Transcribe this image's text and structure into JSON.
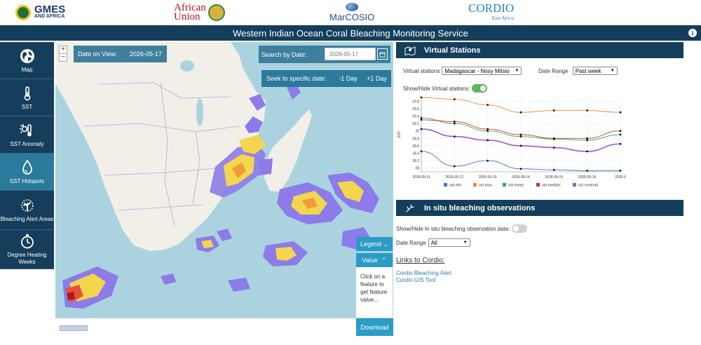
{
  "logos": {
    "gmes": {
      "line1": "GMES",
      "line2": "AND AFRICA"
    },
    "african_union": {
      "line1": "African",
      "line2": "Union"
    },
    "marcosio": "MarCOSIO",
    "cordio": {
      "name": "CORDIO",
      "sub": "East Africa"
    }
  },
  "header": {
    "title": "Western Indian Ocean Coral Bleaching Monitoring Service",
    "info_icon": "i"
  },
  "sidebar": {
    "items": [
      {
        "label": "Map",
        "icon": "globe-icon",
        "active": false
      },
      {
        "label": "SST",
        "icon": "thermometer-icon",
        "active": false
      },
      {
        "label": "SST Anomaly",
        "icon": "sun-thermometer-icon",
        "active": false
      },
      {
        "label": "SST Hotspots",
        "icon": "droplet-icon",
        "active": true
      },
      {
        "label": "Bleaching Alert Areas",
        "icon": "coral-icon",
        "active": false
      },
      {
        "label": "Degree Heating Weeks",
        "icon": "stopwatch-icon",
        "active": false
      }
    ]
  },
  "map": {
    "zoom_in": "+",
    "zoom_out": "−",
    "date_on_view_label": "Date on View:",
    "date_on_view": "2026-05-17",
    "search_label": "Search by Date:",
    "search_placeholder": "2026-05-17",
    "seek_label": "Seek to specific date:",
    "seek_minus": "-1 Day",
    "seek_plus": "+1 Day",
    "legend_label": "Legend",
    "legend_chevron": "⌄",
    "value_label": "Value",
    "value_chevron": "⌃",
    "value_hint": "Click on a feature to get feature value...",
    "download_label": "Download"
  },
  "virtual_stations": {
    "title": "Virtual Stations",
    "station_label": "Virtual stations",
    "station_value": "Madagascar - Nosy Mitsio",
    "date_range_label": "Date Range",
    "date_range_value": "Past week",
    "toggle_label": "Show/Hide Virtual stations:",
    "toggle_on": true
  },
  "insitu": {
    "title": "In situ bleaching observations",
    "toggle_label": "Show/Hide In situ bleaching observation data:",
    "toggle_on": false,
    "date_range_label": "Date Range",
    "date_range_value": "All"
  },
  "links": {
    "title": "Links to Cordio:",
    "items": [
      "Cordio Bleaching Alert",
      "Cordio GIS Tool"
    ]
  },
  "colors": {
    "navy": "#143e5b",
    "teal": "#2b7a9b",
    "accent": "#2b9bc7",
    "ocean": "#aad3df",
    "land": "#f2efe9"
  },
  "chart_data": {
    "type": "line",
    "ylabel": "SST",
    "x": [
      "2026-05-11",
      "2026-05-12",
      "2026-05-13",
      "2026-05-14",
      "2026-05-15",
      "2026-05-16",
      "2026-0"
    ],
    "yticks": [
      "28",
      "28.2",
      "28.4",
      "28.6",
      "28.8",
      "29",
      "29.2",
      "29.4",
      "29.6",
      "29.8"
    ],
    "ylim": [
      27.9,
      29.9
    ],
    "grid": true,
    "legend_position": "bottom",
    "series": [
      {
        "name": "sst min",
        "color": "#3a76c0",
        "values": [
          28.45,
          28.05,
          28.2,
          27.98,
          27.95,
          27.93,
          27.93
        ]
      },
      {
        "name": "sst max",
        "color": "#e8873a",
        "values": [
          29.9,
          29.85,
          29.7,
          29.5,
          29.55,
          29.55,
          29.5
        ]
      },
      {
        "name": "sst mean",
        "color": "#3aa64a",
        "values": [
          29.35,
          29.2,
          29.0,
          28.85,
          28.78,
          28.75,
          28.9
        ]
      },
      {
        "name": "sst median",
        "color": "#c83232",
        "values": [
          29.3,
          29.25,
          29.05,
          28.9,
          28.8,
          28.8,
          29.0
        ]
      },
      {
        "name": "sst centroid",
        "color": "#9b59d0",
        "values": [
          29.05,
          28.85,
          28.75,
          28.6,
          28.55,
          28.45,
          28.65
        ]
      }
    ]
  }
}
